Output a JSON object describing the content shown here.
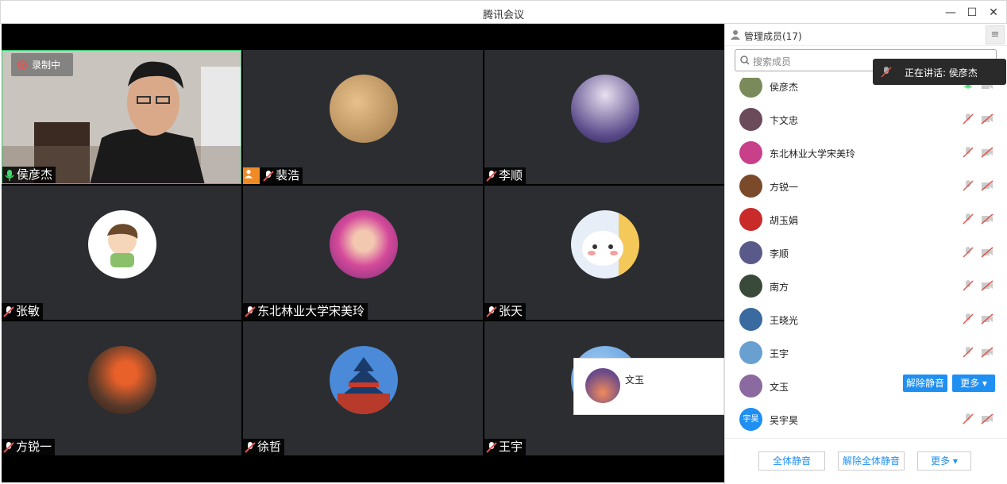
{
  "app": {
    "title": "腾讯会议"
  },
  "video": {
    "recording_label": "录制中",
    "tiles": [
      {
        "name": "侯彦杰",
        "active": true,
        "mic": "on"
      },
      {
        "name": "裴浩",
        "host_icon": true,
        "mic": "muted"
      },
      {
        "name": "李顺",
        "mic": "muted"
      },
      {
        "name": "张敏",
        "mic": "muted"
      },
      {
        "name": "东北林业大学宋美玲",
        "mic": "muted"
      },
      {
        "name": "张天",
        "mic": "muted"
      },
      {
        "name": "方锐一",
        "mic": "muted"
      },
      {
        "name": "徐哲",
        "mic": "muted"
      },
      {
        "name": "王宇",
        "mic": "muted"
      }
    ],
    "popup_name": "文玉"
  },
  "panel": {
    "title": "管理成员(17)",
    "search_placeholder": "搜索成员",
    "speaking": "正在讲话: 侯彦杰",
    "members": [
      {
        "name": "侯彦杰",
        "avatar_color": "#7a8a5a"
      },
      {
        "name": "卞文忠",
        "avatar_color": "#6b4a5a"
      },
      {
        "name": "东北林业大学宋美玲",
        "avatar_color": "#c83f8a"
      },
      {
        "name": "方锐一",
        "avatar_color": "#7a4a2a"
      },
      {
        "name": "胡玉娟",
        "avatar_color": "#c92a2a"
      },
      {
        "name": "李顺",
        "avatar_color": "#5a5a8a"
      },
      {
        "name": "南方",
        "avatar_color": "#3a4a3a"
      },
      {
        "name": "王晓光",
        "avatar_color": "#3a6aa0"
      },
      {
        "name": "王宇",
        "avatar_color": "#6aa0d0"
      },
      {
        "name": "文玉",
        "avatar_color": "#8a6aa0"
      },
      {
        "name": "吴宇昊",
        "avatar_color": "#1f8ff2",
        "avatar_text": "宇昊"
      }
    ],
    "row_actions": {
      "unmute": "解除静音",
      "more": "更多 ▾"
    },
    "footer": {
      "mute_all": "全体静音",
      "unmute_all": "解除全体静音",
      "more": "更多 ▾"
    }
  },
  "colors": {
    "accent": "#1f8ff2",
    "active_border": "#2ecc71",
    "host": "#f08a24",
    "muted_icon": "#e0564f"
  }
}
